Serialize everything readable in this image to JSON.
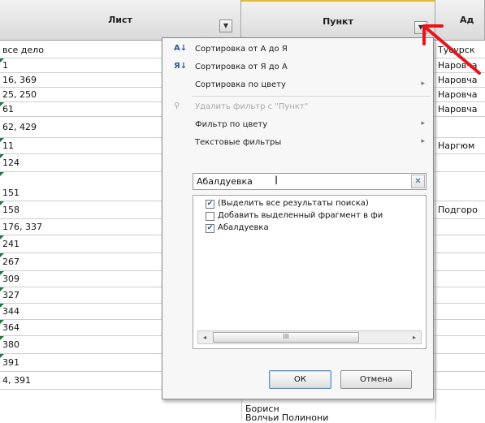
{
  "columns": {
    "a": {
      "header": "Лист"
    },
    "b": {
      "header": "Пункт"
    },
    "c": {
      "header": "Ад"
    }
  },
  "rows": [
    {
      "a": "все дело",
      "c": "Тусурск"
    },
    {
      "a": "1",
      "c": "Наровча"
    },
    {
      "a": "16, 369",
      "c": "Наровча"
    },
    {
      "a": "25, 250",
      "c": "Наровча"
    },
    {
      "a": "61",
      "c": "Наровча"
    },
    {
      "a": "62, 429",
      "c": ""
    },
    {
      "a": "11",
      "c": "Наргюм"
    },
    {
      "a": "124",
      "c": ""
    },
    {
      "a": "151",
      "c": ""
    },
    {
      "a": "158",
      "c": "Подгоро"
    },
    {
      "a": "176, 337",
      "c": ""
    },
    {
      "a": "241",
      "c": ""
    },
    {
      "a": "267",
      "c": ""
    },
    {
      "a": "309",
      "c": ""
    },
    {
      "a": "327",
      "c": ""
    },
    {
      "a": "344",
      "c": ""
    },
    {
      "a": "364",
      "c": ""
    },
    {
      "a": "380",
      "c": ""
    },
    {
      "a": "391",
      "c": ""
    },
    {
      "a": "4, 391",
      "c": ""
    }
  ],
  "below_text": {
    "row18": "Борисн",
    "row19": "Волчьи Полинони"
  },
  "menu": {
    "sort_asc": "Сортировка от А до Я",
    "sort_desc": "Сортировка от Я до А",
    "sort_color": "Сортировка по цвету",
    "clear_filter": "Удалить фильтр с \"Пункт\"",
    "filter_color": "Фильтр по цвету",
    "text_filters": "Текстовые фильтры",
    "search_value": "Абалдуевка",
    "items": [
      "(Выделить все результаты поиска)",
      "Добавить выделенный фрагмент в фи",
      "Абалдуевка"
    ],
    "scroll_thumb": "III",
    "ok": "ОК",
    "cancel": "Отмена"
  },
  "icons": {
    "sort_asc": "sort-asc-icon",
    "sort_desc": "sort-desc-icon",
    "clear_filter": "funnel-clear-icon",
    "filter_dropdown": "chevron-down-icon",
    "annotation": "red-arrow-icon"
  },
  "colors": {
    "arrow": "#e8141c",
    "accent": "#2b5797"
  }
}
